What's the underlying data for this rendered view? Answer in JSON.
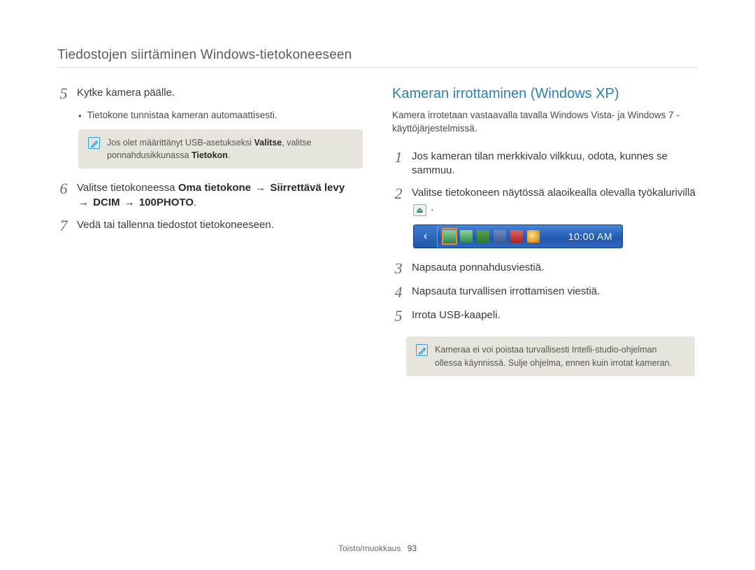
{
  "header": {
    "topic": "Tiedostojen siirtäminen Windows-tietokoneeseen"
  },
  "left": {
    "steps": {
      "s5": {
        "num": "5",
        "text": "Kytke kamera päälle."
      },
      "s5_bullet": "Tietokone tunnistaa kameran automaattisesti.",
      "note1": {
        "pre": "Jos olet määrittänyt USB-asetukseksi ",
        "bold1": "Valitse",
        "mid": ", valitse ponnahdusikkunassa ",
        "bold2": "Tietokon",
        "post": "."
      },
      "s6": {
        "num": "6",
        "pre": "Valitse tietokoneessa ",
        "b1": "Oma tietokone",
        "arrow": "→",
        "b2": "Siirrettävä levy",
        "b3": "DCIM",
        "b4": "100PHOTO",
        "post": "."
      },
      "s7": {
        "num": "7",
        "text": "Vedä tai tallenna tiedostot tietokoneeseen."
      }
    }
  },
  "right": {
    "heading": "Kameran irrottaminen (Windows XP)",
    "intro": "Kamera irrotetaan vastaavalla tavalla Windows Vista- ja Windows 7 -käyttöjärjestelmissä.",
    "steps": {
      "s1": {
        "num": "1",
        "text": "Jos kameran tilan merkkivalo vilkkuu, odota, kunnes se sammuu."
      },
      "s2": {
        "num": "2",
        "pre": "Valitse tietokoneen näytössä alaoikealla olevalla työkalurivillä ",
        "post": " ."
      },
      "s3": {
        "num": "3",
        "text": "Napsauta ponnahdusviestiä."
      },
      "s4": {
        "num": "4",
        "text": "Napsauta turvallisen irrottamisen viestiä."
      },
      "s5": {
        "num": "5",
        "text": "Irrota USB-kaapeli."
      }
    },
    "taskbar": {
      "clock": "10:00 AM",
      "icons": [
        "safely-remove-icon",
        "device-icon",
        "shield-ok-icon",
        "network-icon",
        "volume-icon",
        "update-icon"
      ]
    },
    "note2": "Kameraa ei voi poistaa turvallisesti Intelli-studio-ohjelman ollessa käynnissä. Sulje ohjelma, ennen kuin irrotat kameran."
  },
  "footer": {
    "section": "Toisto/muokkaus",
    "page": "93"
  }
}
